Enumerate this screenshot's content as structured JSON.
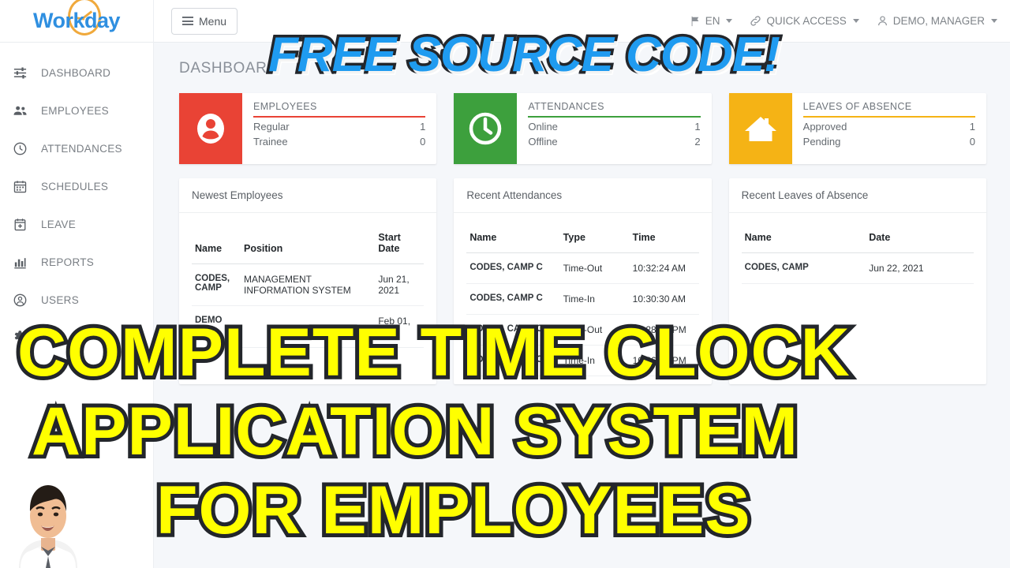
{
  "brand": {
    "name": "Workday",
    "icon": "clock-icon"
  },
  "topbar": {
    "menu_label": "Menu",
    "nav": [
      {
        "label": "EN",
        "icon": "flag-icon"
      },
      {
        "label": "QUICK ACCESS",
        "icon": "link-icon"
      },
      {
        "label": "DEMO, MANAGER",
        "icon": "user-icon"
      }
    ]
  },
  "sidebar": {
    "items": [
      {
        "label": "DASHBOARD",
        "icon": "sliders-icon"
      },
      {
        "label": "EMPLOYEES",
        "icon": "people-icon"
      },
      {
        "label": "ATTENDANCES",
        "icon": "clock-icon"
      },
      {
        "label": "SCHEDULES",
        "icon": "calendar-icon"
      },
      {
        "label": "LEAVE",
        "icon": "calendar-plus-icon"
      },
      {
        "label": "REPORTS",
        "icon": "bar-chart-icon"
      },
      {
        "label": "USERS",
        "icon": "user-circle-icon"
      }
    ],
    "settings_icon": "gear-icon"
  },
  "main": {
    "page_title": "DASHBOARD",
    "cards": [
      {
        "title": "EMPLOYEES",
        "icon": "person-icon",
        "color": "#e94335",
        "rows": [
          {
            "label": "Regular",
            "value": "1"
          },
          {
            "label": "Trainee",
            "value": "0"
          }
        ]
      },
      {
        "title": "ATTENDANCES",
        "icon": "clock-icon",
        "color": "#3da03d",
        "rows": [
          {
            "label": "Online",
            "value": "1"
          },
          {
            "label": "Offline",
            "value": "2"
          }
        ]
      },
      {
        "title": "LEAVES OF ABSENCE",
        "icon": "home-icon",
        "color": "#f5b315",
        "rows": [
          {
            "label": "Approved",
            "value": "1"
          },
          {
            "label": "Pending",
            "value": "0"
          }
        ]
      }
    ],
    "panels": [
      {
        "title": "Newest Employees",
        "columns": [
          "Name",
          "Position",
          "Start Date"
        ],
        "rows": [
          {
            "name": "CODES, CAMP",
            "position": "MANAGEMENT INFORMATION SYSTEM",
            "date": "Jun 21, 2021"
          },
          {
            "name": "DEMO",
            "position": "",
            "date": "Feb 01, 2020"
          }
        ]
      },
      {
        "title": "Recent Attendances",
        "columns": [
          "Name",
          "Type",
          "Time"
        ],
        "rows": [
          {
            "name": "CODES, CAMP C",
            "type": "Time-Out",
            "time": "10:32:24 AM"
          },
          {
            "name": "CODES, CAMP C",
            "type": "Time-In",
            "time": "10:30:30 AM"
          },
          {
            "name": "CODES, CAMP C",
            "type": "Time-Out",
            "time": "10:28:10 PM"
          },
          {
            "name": "CODES, CAMP C",
            "type": "Time-In",
            "time": "10:26:32 PM"
          }
        ]
      },
      {
        "title": "Recent Leaves of Absence",
        "columns": [
          "Name",
          "Date"
        ],
        "rows": [
          {
            "name": "CODES, CAMP",
            "date": "Jun 22, 2021"
          }
        ]
      }
    ]
  },
  "overlay": {
    "headline": "FREE SOURCE CODE!",
    "line1": "COMPLETE TIME CLOCK",
    "line2": "APPLICATION SYSTEM",
    "line3": "FOR EMPLOYEES",
    "headline_color": "#1f9bf0",
    "body_color": "#ffff00"
  }
}
